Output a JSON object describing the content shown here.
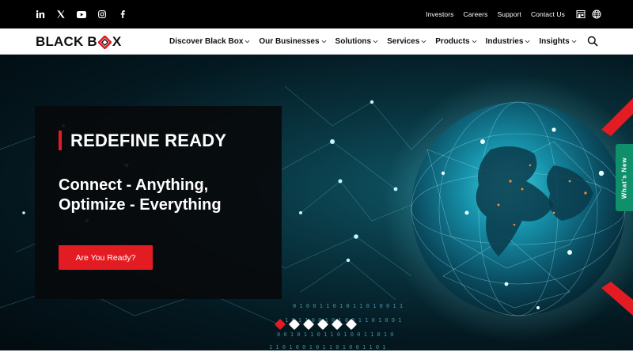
{
  "topbar": {
    "social": [
      {
        "name": "linkedin-icon",
        "glyph": "in"
      },
      {
        "name": "x-twitter-icon",
        "glyph": "X"
      },
      {
        "name": "youtube-icon",
        "glyph": "YT"
      },
      {
        "name": "instagram-icon",
        "glyph": "IG"
      },
      {
        "name": "facebook-icon",
        "glyph": "f"
      }
    ],
    "links": [
      "Investors",
      "Careers",
      "Support",
      "Contact Us"
    ],
    "icons": [
      "store-icon",
      "globe-icon"
    ]
  },
  "brand": {
    "part1": "BLACK B",
    "part2": "X",
    "accent_color": "#e31b23"
  },
  "nav": {
    "items": [
      "Discover Black Box",
      "Our Businesses",
      "Solutions",
      "Services",
      "Products",
      "Industries",
      "Insights"
    ]
  },
  "hero": {
    "heading": "REDEFINE READY",
    "line1": "Connect - Anything,",
    "line2": "Optimize - Everything",
    "cta": "Are You Ready?",
    "slides": 6,
    "active_slide": 1
  },
  "side_tab": {
    "label": "What's New",
    "color": "#0f8f6a"
  }
}
